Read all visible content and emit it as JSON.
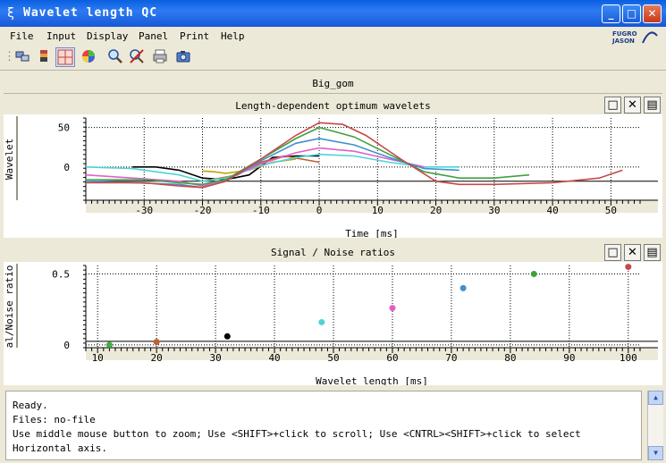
{
  "window": {
    "title": "Wavelet length QC",
    "app_icon": "ξ"
  },
  "menu": [
    "File",
    "Input",
    "Display",
    "Panel",
    "Print",
    "Help"
  ],
  "logo": {
    "line1": "FUGRO",
    "line2": "JASON"
  },
  "toolbar": {
    "icons": [
      "cascade-windows-icon",
      "layers-icon",
      "crosshair-grid-icon",
      "color-wheel-icon",
      "zoom-icon",
      "no-zoom-icon",
      "print-icon",
      "camera-icon"
    ]
  },
  "dataset": "Big_gom",
  "panel1": {
    "title": "Length-dependent optimum wavelets",
    "ylabel": "Wavelet",
    "xlabel": "Time [ms]",
    "yticks": [
      "50",
      "0"
    ],
    "xticks": [
      "-30",
      "-20",
      "-10",
      "0",
      "10",
      "20",
      "30",
      "40",
      "50"
    ]
  },
  "panel2": {
    "title": "Signal / Noise ratios",
    "ylabel": "al/Noise ratio",
    "xlabel": "Wavelet length [ms]",
    "yticks": [
      "0.5",
      "0"
    ],
    "xticks": [
      "10",
      "20",
      "30",
      "40",
      "50",
      "60",
      "70",
      "80",
      "90",
      "100"
    ]
  },
  "chart_data": [
    {
      "type": "line",
      "title": "Length-dependent optimum wavelets",
      "xlabel": "Time [ms]",
      "ylabel": "Wavelet",
      "xlim": [
        -40,
        55
      ],
      "ylim": [
        -42,
        62
      ],
      "grid": true,
      "series": [
        {
          "color": "#000000",
          "x": [
            -32,
            -28,
            -24,
            -20,
            -16,
            -12,
            -8,
            -4,
            0
          ],
          "y": [
            0,
            0,
            -4,
            -14,
            -16,
            -10,
            12,
            14,
            14
          ]
        },
        {
          "color": "#C8A000",
          "x": [
            -20,
            -18,
            -16,
            -12,
            -8,
            -4
          ],
          "y": [
            -5,
            -6,
            -8,
            -4,
            6,
            10
          ]
        },
        {
          "color": "#C06030",
          "x": [
            -20,
            -14,
            -10,
            -6,
            0
          ],
          "y": [
            -18,
            -10,
            6,
            14,
            6
          ]
        },
        {
          "color": "#4ED4D8",
          "x": [
            -40,
            -32,
            -24,
            -20,
            -16,
            -10,
            -4,
            0,
            6,
            12,
            18,
            24
          ],
          "y": [
            0,
            -2,
            -10,
            -18,
            -14,
            2,
            12,
            16,
            14,
            6,
            0,
            0
          ]
        },
        {
          "color": "#E060C8",
          "x": [
            -40,
            -32,
            -24,
            -20,
            -16,
            -10,
            -4,
            0,
            6,
            12,
            18
          ],
          "y": [
            -10,
            -14,
            -18,
            -24,
            -16,
            4,
            18,
            24,
            20,
            10,
            0
          ]
        },
        {
          "color": "#4090D0",
          "x": [
            -40,
            -32,
            -24,
            -20,
            -16,
            -10,
            -4,
            0,
            6,
            12,
            18,
            24
          ],
          "y": [
            -18,
            -20,
            -22,
            -26,
            -18,
            8,
            30,
            36,
            28,
            12,
            -2,
            -4
          ]
        },
        {
          "color": "#40A040",
          "x": [
            -40,
            -30,
            -24,
            -20,
            -16,
            -10,
            -4,
            0,
            6,
            12,
            18,
            24,
            30,
            36
          ],
          "y": [
            -16,
            -16,
            -20,
            -22,
            -16,
            10,
            36,
            50,
            38,
            16,
            -6,
            -14,
            -14,
            -10
          ]
        },
        {
          "color": "#C84848",
          "x": [
            -40,
            -30,
            -24,
            -20,
            -16,
            -10,
            -4,
            0,
            4,
            8,
            14,
            20,
            24,
            30,
            40,
            48,
            52
          ],
          "y": [
            -20,
            -20,
            -24,
            -26,
            -18,
            10,
            40,
            56,
            54,
            40,
            10,
            -18,
            -22,
            -22,
            -20,
            -14,
            -4
          ]
        }
      ]
    },
    {
      "type": "scatter",
      "title": "Signal / Noise ratios",
      "xlabel": "Wavelet length [ms]",
      "ylabel": "al/Noise ratio",
      "xlim": [
        8,
        102
      ],
      "ylim": [
        -0.02,
        0.56
      ],
      "grid": true,
      "points": [
        {
          "x": 12,
          "y": 0.0,
          "color": "#40B040"
        },
        {
          "x": 20,
          "y": 0.02,
          "color": "#C06030"
        },
        {
          "x": 32,
          "y": 0.06,
          "color": "#000000"
        },
        {
          "x": 48,
          "y": 0.16,
          "color": "#4ED4D8"
        },
        {
          "x": 60,
          "y": 0.26,
          "color": "#E060C8"
        },
        {
          "x": 72,
          "y": 0.4,
          "color": "#4090D0"
        },
        {
          "x": 84,
          "y": 0.5,
          "color": "#40A040"
        },
        {
          "x": 100,
          "y": 0.55,
          "color": "#C84848"
        }
      ]
    }
  ],
  "status": {
    "lines": [
      "Ready.",
      "Files: no-file",
      "Use middle mouse button to zoom; Use <SHIFT>+click to scroll; Use <CNTRL><SHIFT>+click to select",
      "Horizontal axis."
    ]
  },
  "colors": {
    "titlebar": "#0A5FE0",
    "background": "#ECE9D8",
    "grid": "#000000"
  }
}
